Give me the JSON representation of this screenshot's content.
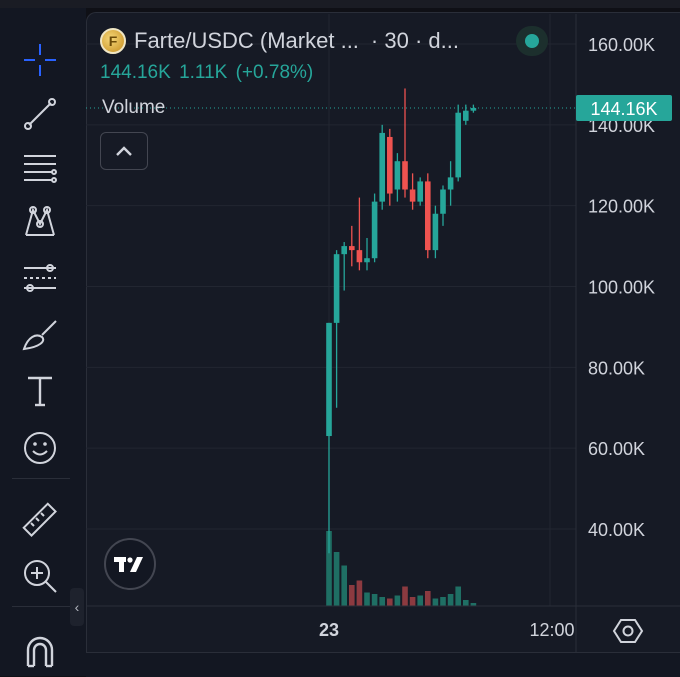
{
  "header": {
    "symbol": "Farte/USDC (Market ...",
    "interval": "· 30 · d...",
    "last_price": "144.16K",
    "change": "1.11K",
    "change_pct": "(+0.78%)",
    "coin_glyph": "F",
    "status_color": "#26a69a"
  },
  "volume_label": "Volume",
  "price_tag": "144.16K",
  "colors": {
    "up": "#26a69a",
    "down": "#ef5350",
    "vol_up": "#1f6f64",
    "vol_down": "#8c3a40",
    "grid": "#222631",
    "background": "#161a25"
  },
  "toolbar": {
    "icons": [
      "crosshair-icon",
      "trend-line-icon",
      "fib-retracement-icon",
      "pattern-icon",
      "prediction-icon",
      "brush-icon",
      "text-icon",
      "emoji-icon",
      "ruler-icon",
      "zoom-in-icon",
      "magnet-icon"
    ]
  },
  "chart_data": {
    "type": "candlestick",
    "title": "Farte/USDC (Market ...",
    "interval": "30",
    "y_ticks": [
      "160.00K",
      "140.00K",
      "120.00K",
      "100.00K",
      "80.00K",
      "60.00K",
      "40.00K"
    ],
    "y_tick_values": [
      160000,
      140000,
      120000,
      100000,
      80000,
      60000,
      40000
    ],
    "x_tick_labels": [
      "23",
      "12:00"
    ],
    "ylim": [
      34000,
      164000
    ],
    "last_price_line": 144160,
    "candles": [
      {
        "o": 63000,
        "h": 91000,
        "l": 34000,
        "c": 91000,
        "v": 100
      },
      {
        "o": 91000,
        "h": 109000,
        "l": 70000,
        "c": 108000,
        "v": 72
      },
      {
        "o": 108000,
        "h": 111000,
        "l": 99000,
        "c": 110000,
        "v": 54
      },
      {
        "o": 110000,
        "h": 115000,
        "l": 105000,
        "c": 109000,
        "v": 28
      },
      {
        "o": 109000,
        "h": 122000,
        "l": 104000,
        "c": 106000,
        "v": 34
      },
      {
        "o": 106000,
        "h": 112000,
        "l": 104000,
        "c": 107000,
        "v": 18
      },
      {
        "o": 107000,
        "h": 123000,
        "l": 106000,
        "c": 121000,
        "v": 16
      },
      {
        "o": 121000,
        "h": 140000,
        "l": 119000,
        "c": 138000,
        "v": 12
      },
      {
        "o": 137000,
        "h": 139000,
        "l": 120000,
        "c": 123000,
        "v": 10
      },
      {
        "o": 124000,
        "h": 133000,
        "l": 121000,
        "c": 131000,
        "v": 14
      },
      {
        "o": 131000,
        "h": 149000,
        "l": 122000,
        "c": 124000,
        "v": 26
      },
      {
        "o": 124000,
        "h": 128000,
        "l": 119000,
        "c": 121000,
        "v": 12
      },
      {
        "o": 121000,
        "h": 127000,
        "l": 120000,
        "c": 126000,
        "v": 14
      },
      {
        "o": 126000,
        "h": 128000,
        "l": 107000,
        "c": 109000,
        "v": 20
      },
      {
        "o": 109000,
        "h": 120000,
        "l": 107000,
        "c": 118000,
        "v": 10
      },
      {
        "o": 118000,
        "h": 125000,
        "l": 115000,
        "c": 124000,
        "v": 12
      },
      {
        "o": 124000,
        "h": 131000,
        "l": 120000,
        "c": 127000,
        "v": 16
      },
      {
        "o": 127000,
        "h": 145000,
        "l": 126000,
        "c": 143000,
        "v": 26
      },
      {
        "o": 141000,
        "h": 145000,
        "l": 140000,
        "c": 143500,
        "v": 8
      },
      {
        "o": 143500,
        "h": 145000,
        "l": 143000,
        "c": 144160,
        "v": 4
      }
    ]
  }
}
